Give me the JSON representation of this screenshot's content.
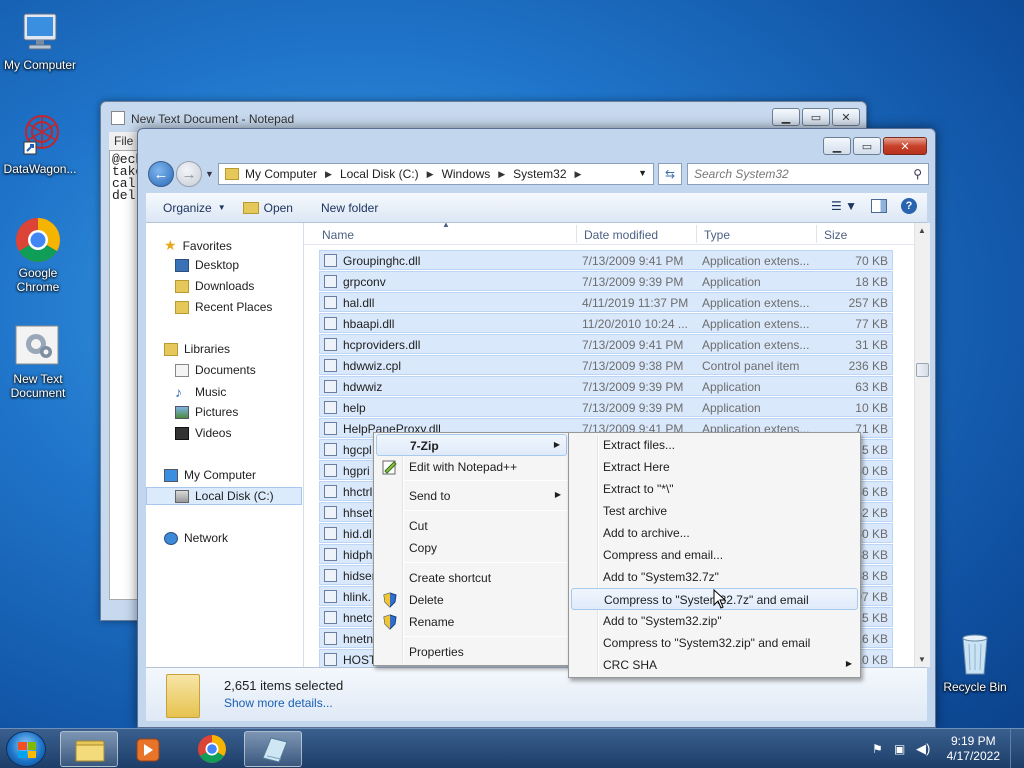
{
  "desktop": {
    "icons": [
      {
        "label": "My Computer"
      },
      {
        "label": "DataWagon..."
      },
      {
        "label": "Google Chrome"
      },
      {
        "label": "New Text Document"
      },
      {
        "label": "Recycle Bin"
      }
    ]
  },
  "notepad": {
    "title": "New Text Document - Notepad",
    "menu_file": "File",
    "content": "@ech\ntake\ncal:\ndel"
  },
  "explorer": {
    "breadcrumb": [
      "My Computer",
      "Local Disk (C:)",
      "Windows",
      "System32"
    ],
    "search_placeholder": "Search System32",
    "toolbar": {
      "organize": "Organize",
      "open": "Open",
      "new_folder": "New folder"
    },
    "nav": {
      "favorites": "Favorites",
      "desktop": "Desktop",
      "downloads": "Downloads",
      "recent": "Recent Places",
      "libraries": "Libraries",
      "documents": "Documents",
      "music": "Music",
      "pictures": "Pictures",
      "videos": "Videos",
      "computer": "My Computer",
      "local_disk": "Local Disk (C:)",
      "network": "Network"
    },
    "columns": {
      "name": "Name",
      "date": "Date modified",
      "type": "Type",
      "size": "Size"
    },
    "files": [
      {
        "name": "Groupinghc.dll",
        "date": "7/13/2009 9:41 PM",
        "type": "Application extens...",
        "size": "70 KB"
      },
      {
        "name": "grpconv",
        "date": "7/13/2009 9:39 PM",
        "type": "Application",
        "size": "18 KB"
      },
      {
        "name": "hal.dll",
        "date": "4/11/2019 11:37 PM",
        "type": "Application extens...",
        "size": "257 KB"
      },
      {
        "name": "hbaapi.dll",
        "date": "11/20/2010 10:24 ...",
        "type": "Application extens...",
        "size": "77 KB"
      },
      {
        "name": "hcproviders.dll",
        "date": "7/13/2009 9:41 PM",
        "type": "Application extens...",
        "size": "31 KB"
      },
      {
        "name": "hdwwiz.cpl",
        "date": "7/13/2009 9:38 PM",
        "type": "Control panel item",
        "size": "236 KB"
      },
      {
        "name": "hdwwiz",
        "date": "7/13/2009 9:39 PM",
        "type": "Application",
        "size": "63 KB"
      },
      {
        "name": "help",
        "date": "7/13/2009 9:39 PM",
        "type": "Application",
        "size": "10 KB"
      },
      {
        "name": "HelpPaneProxy.dll",
        "date": "7/13/2009 9:41 PM",
        "type": "Application extens...",
        "size": "71 KB"
      },
      {
        "name": "hgcpl",
        "date": "",
        "type": "",
        "size": "25 KB"
      },
      {
        "name": "hgpri",
        "date": "",
        "type": "",
        "size": "30 KB"
      },
      {
        "name": "hhctrl",
        "date": "",
        "type": "",
        "size": "36 KB"
      },
      {
        "name": "hhset",
        "date": "",
        "type": "",
        "size": "52 KB"
      },
      {
        "name": "hid.dl",
        "date": "",
        "type": "",
        "size": "30 KB"
      },
      {
        "name": "hidph",
        "date": "",
        "type": "",
        "size": "38 KB"
      },
      {
        "name": "hidser",
        "date": "",
        "type": "",
        "size": "38 KB"
      },
      {
        "name": "hlink.",
        "date": "",
        "type": "",
        "size": "07 KB"
      },
      {
        "name": "hnetc",
        "date": "",
        "type": "",
        "size": "15 KB"
      },
      {
        "name": "hnetn",
        "date": "",
        "type": "",
        "size": "16 KB"
      },
      {
        "name": "HOST",
        "date": "",
        "type": "",
        "size": "10 KB"
      }
    ],
    "details": {
      "count": "2,651 items selected",
      "more": "Show more details..."
    }
  },
  "context_menu": {
    "items": [
      "7-Zip",
      "Edit with Notepad++",
      "Send to",
      "Cut",
      "Copy",
      "Create shortcut",
      "Delete",
      "Rename",
      "Properties"
    ]
  },
  "submenu": {
    "items": [
      "Extract files...",
      "Extract Here",
      "Extract to \"*\\\"",
      "Test archive",
      "Add to archive...",
      "Compress and email...",
      "Add to \"System32.7z\"",
      "Compress to \"System32.7z\" and email",
      "Add to \"System32.zip\"",
      "Compress to \"System32.zip\" and email",
      "CRC SHA"
    ]
  },
  "taskbar": {
    "time": "9:19 PM",
    "date": "4/17/2022"
  },
  "colors": {
    "accent": "#1f74c9",
    "selection": "#d9e8fb"
  }
}
